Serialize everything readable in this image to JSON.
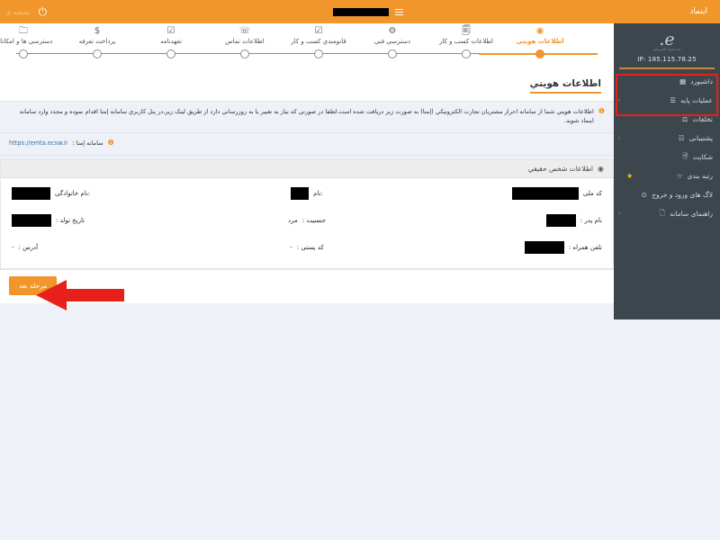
{
  "topbar": {
    "brand": "اینماد",
    "menu_icon": "hamburger-icon",
    "user_redacted": "",
    "power_icon": "power-icon",
    "version_text": "نسخه ی"
  },
  "sidebar": {
    "logo_mark": "e.",
    "logo_sub": "نماد اعتماد الکترونیکی",
    "ip_label": "IP: 185.115.78.25",
    "items": [
      {
        "label": "داشبورد",
        "icon": "dashboard-icon",
        "caret": "",
        "star": ""
      },
      {
        "label": "عملیات پایه",
        "icon": "list-icon",
        "caret": "‹",
        "star": ""
      },
      {
        "label": "تخلفات",
        "icon": "gavel-icon",
        "caret": "",
        "star": ""
      },
      {
        "label": "پشتیبانی",
        "icon": "chat-icon",
        "caret": "‹",
        "star": ""
      },
      {
        "label": "شکایت",
        "icon": "file-icon",
        "caret": "",
        "star": ""
      },
      {
        "label": "رتبه بندی",
        "icon": "star-outline-icon",
        "caret": "",
        "star": "★"
      },
      {
        "label": "لاگ های ورود و خروج",
        "icon": "clock-icon",
        "caret": "",
        "star": ""
      },
      {
        "label": "راهنمای سامانه",
        "icon": "book-icon",
        "caret": "‹",
        "star": ""
      }
    ]
  },
  "stepper": {
    "steps": [
      {
        "label": "اطلاعات هویتی",
        "icon": "user-circle-icon",
        "active": true
      },
      {
        "label": "اطلاعات کسب و کار",
        "icon": "document-icon",
        "active": false
      },
      {
        "label": "دسترسی فنی",
        "icon": "gears-icon",
        "active": false
      },
      {
        "label": "قانومندي کسب و کار",
        "icon": "check-square-icon",
        "active": false
      },
      {
        "label": "اطلاعات تماس",
        "icon": "phone-icon",
        "active": false
      },
      {
        "label": "تعهدنامه",
        "icon": "check-square-icon",
        "active": false
      },
      {
        "label": "پرداخت تعرفه",
        "icon": "dollar-icon",
        "active": false
      },
      {
        "label": "دسترسی ها و امکانات",
        "icon": "folder-icon",
        "active": false
      }
    ]
  },
  "main": {
    "page_title": "اطلاعات هويتي",
    "alert_1": "اطلاعات هويتي شما از سامانه احراز مشتريان تجارت الكترونيكي (إمتا) به صورت زير دريافت شده است.لطفا در صورتي كه نياز به تغيير يا به روزرساني دارد از طريق لينک زير،در پنل كاربري سامانه إمتا اقدام نموده و مجدد وارد سامانه اينماد شويد.",
    "alert_2_label": "سامانه إمتا :",
    "alert_2_link": "https://emta.ecsw.ir",
    "panel_title": "اطلاعات شخص حقيقي",
    "fields": {
      "national_id_label": "کد ملی",
      "national_id_value": "",
      "first_name_label": ":نام",
      "first_name_value": "",
      "last_name_label": ":نام خانوادگی",
      "last_name_value": "",
      "father_name_label": "نام پدر :",
      "father_name_value": "",
      "gender_label": "جنسیت :",
      "gender_value": "مرد",
      "birth_date_label": "تاریخ تولد :",
      "birth_date_value": "",
      "mobile_label": "تلفن همراه :",
      "mobile_value": "",
      "postal_code_label": "کد پستی :",
      "postal_code_value": "-",
      "address_label": "آدرس :",
      "address_value": "-"
    },
    "next_button": "مرحله بعد"
  },
  "colors": {
    "accent_orange": "#f0962a",
    "sidebar_dark": "#3d464d",
    "annotation_red": "#e8201a",
    "page_bg": "#eef1f7",
    "link_blue": "#3a6fb5"
  }
}
